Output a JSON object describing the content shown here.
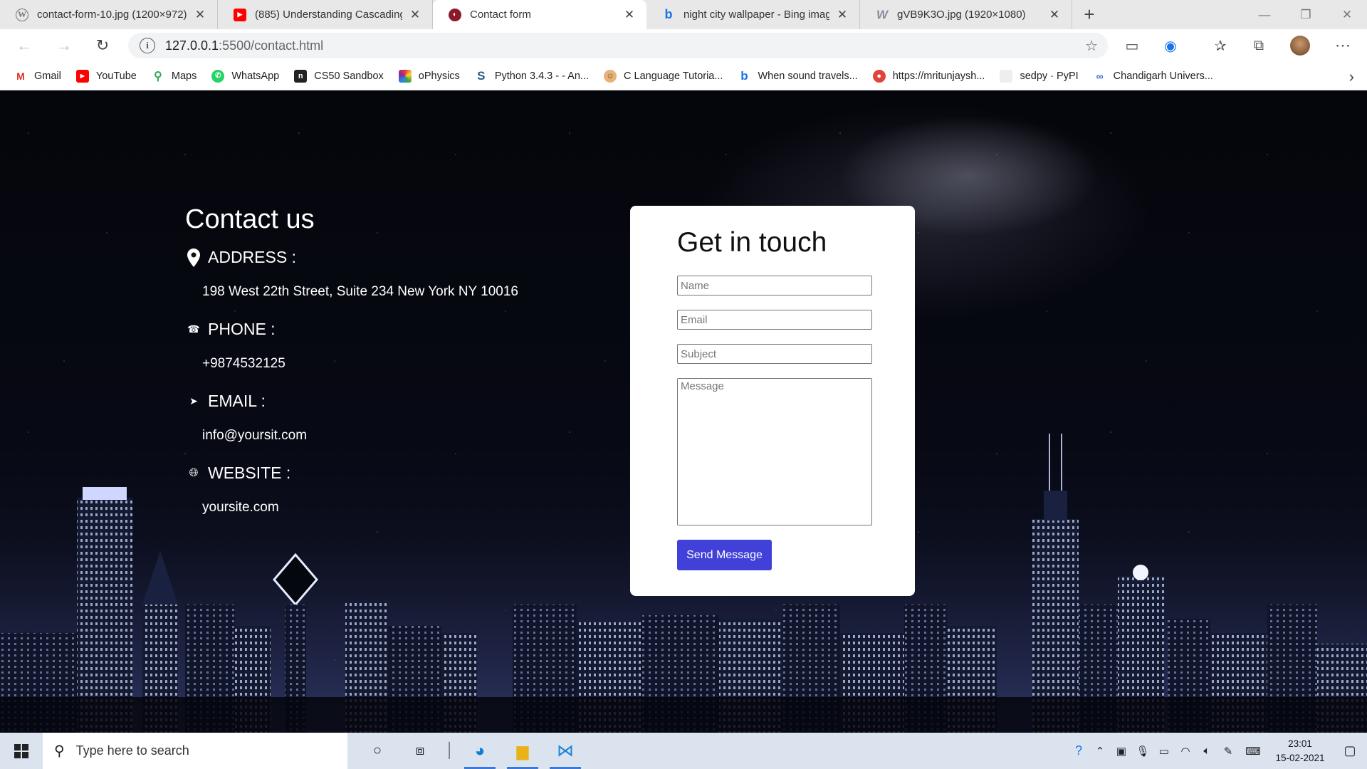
{
  "browser": {
    "tabs": [
      {
        "title": "contact-form-10.jpg (1200×972)",
        "icon": "wordpress-icon"
      },
      {
        "title": "(885) Understanding Cascading",
        "icon": "youtube-icon"
      },
      {
        "title": "Contact form",
        "icon": "page-favicon-icon",
        "active": true
      },
      {
        "title": "night city wallpaper - Bing imag",
        "icon": "bing-icon"
      },
      {
        "title": "gVB9K3O.jpg (1920×1080)",
        "icon": "wallhaven-icon"
      }
    ],
    "url_host": "127.0.0.1",
    "url_rest": ":5500/contact.html",
    "bookmarks": [
      {
        "label": "Gmail",
        "icon": "gmail-icon",
        "color": "#d93025"
      },
      {
        "label": "YouTube",
        "icon": "youtube-icon",
        "color": "#ff0000"
      },
      {
        "label": "Maps",
        "icon": "maps-icon",
        "color": "#34a853"
      },
      {
        "label": "WhatsApp",
        "icon": "whatsapp-icon",
        "color": "#25d366"
      },
      {
        "label": "CS50 Sandbox",
        "icon": "cs50-icon",
        "color": "#222222"
      },
      {
        "label": "oPhysics",
        "icon": "ophysics-icon",
        "color": "#7b3fe4"
      },
      {
        "label": "Python 3.4.3 - - An...",
        "icon": "python-icon",
        "color": "#2b5b84"
      },
      {
        "label": "C Language Tutoria...",
        "icon": "c-language-icon",
        "color": "#b5651d"
      },
      {
        "label": "When sound travels...",
        "icon": "bing-icon",
        "color": "#1a73e8"
      },
      {
        "label": "https://mritunjaysh...",
        "icon": "site-icon",
        "color": "#e0453a"
      },
      {
        "label": "sedpy · PyPI",
        "icon": "pypi-icon",
        "color": "#dddddd"
      },
      {
        "label": "Chandigarh Univers...",
        "icon": "cu-icon",
        "color": "#3367d6"
      }
    ]
  },
  "contact": {
    "title": "Contact us",
    "address_label": "ADDRESS :",
    "address_value": "198 West 22th Street, Suite 234 New York NY 10016",
    "phone_label": "PHONE :",
    "phone_value": "+9874532125",
    "email_label": "EMAIL :",
    "email_value": "info@yoursit.com",
    "website_label": "WEBSITE :",
    "website_value": "yoursite.com"
  },
  "form": {
    "title": "Get in touch",
    "name_placeholder": "Name",
    "email_placeholder": "Email",
    "subject_placeholder": "Subject",
    "message_placeholder": "Message",
    "send_label": "Send Message",
    "accent_color": "#4141d9"
  },
  "taskbar": {
    "search_placeholder": "Type here to search",
    "time": "23:01",
    "date": "15-02-2021"
  }
}
